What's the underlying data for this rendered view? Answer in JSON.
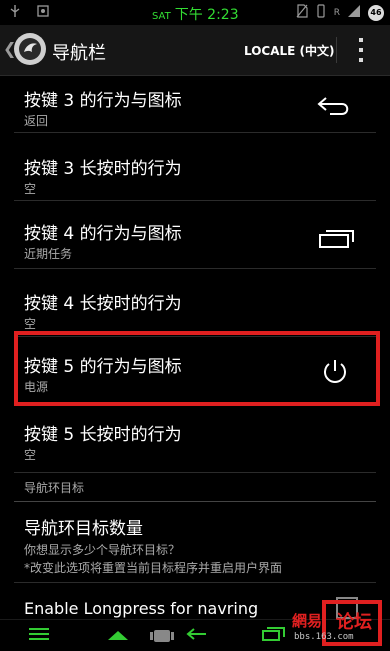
{
  "status_bar": {
    "day": "SAT",
    "time": "下午 2:23",
    "signal_label": "R",
    "battery_level": "46",
    "icons": [
      "usb-icon",
      "notification-icon",
      "no-sim-icon",
      "rotate-icon",
      "wifi-icon",
      "signal-icon",
      "battery-icon"
    ]
  },
  "action_bar": {
    "title": "导航栏",
    "locale_button": "LOCALE (中文)",
    "icons": [
      "back-chevron-icon",
      "app-logo-icon",
      "overflow-menu-icon"
    ]
  },
  "preferences": [
    {
      "title": "按键 3 的行为与图标",
      "summary": "返回",
      "icon": "back-arrow-icon"
    },
    {
      "title": "按键 3 长按时的行为",
      "summary": "空"
    },
    {
      "title": "按键 4 的行为与图标",
      "summary": "近期任务",
      "icon": "recent-apps-icon"
    },
    {
      "title": "按键 4 长按时的行为",
      "summary": "空"
    },
    {
      "title": "按键 5 的行为与图标",
      "summary": "电源",
      "icon": "power-icon"
    },
    {
      "title": "按键 5 长按时的行为",
      "summary": "空"
    }
  ],
  "section": {
    "title": "导航环目标"
  },
  "navring": {
    "title": "导航环目标数量",
    "summary_line1": "你想显示多少个导航环目标？",
    "summary_line2": "*改变此选项将重置当前目标程序并重启用户界面"
  },
  "longpress": {
    "title": "Enable Longpress for navring"
  },
  "nav_bar": {
    "icons": [
      "menu-icon",
      "home-icon",
      "android-icon",
      "back-icon",
      "recent-apps-icon"
    ]
  },
  "watermark": {
    "text1": "網易",
    "text2": "论坛",
    "url": "bbs.163.com"
  },
  "colors": {
    "accent_red": "#e02020",
    "status_green": "#33dd33"
  }
}
